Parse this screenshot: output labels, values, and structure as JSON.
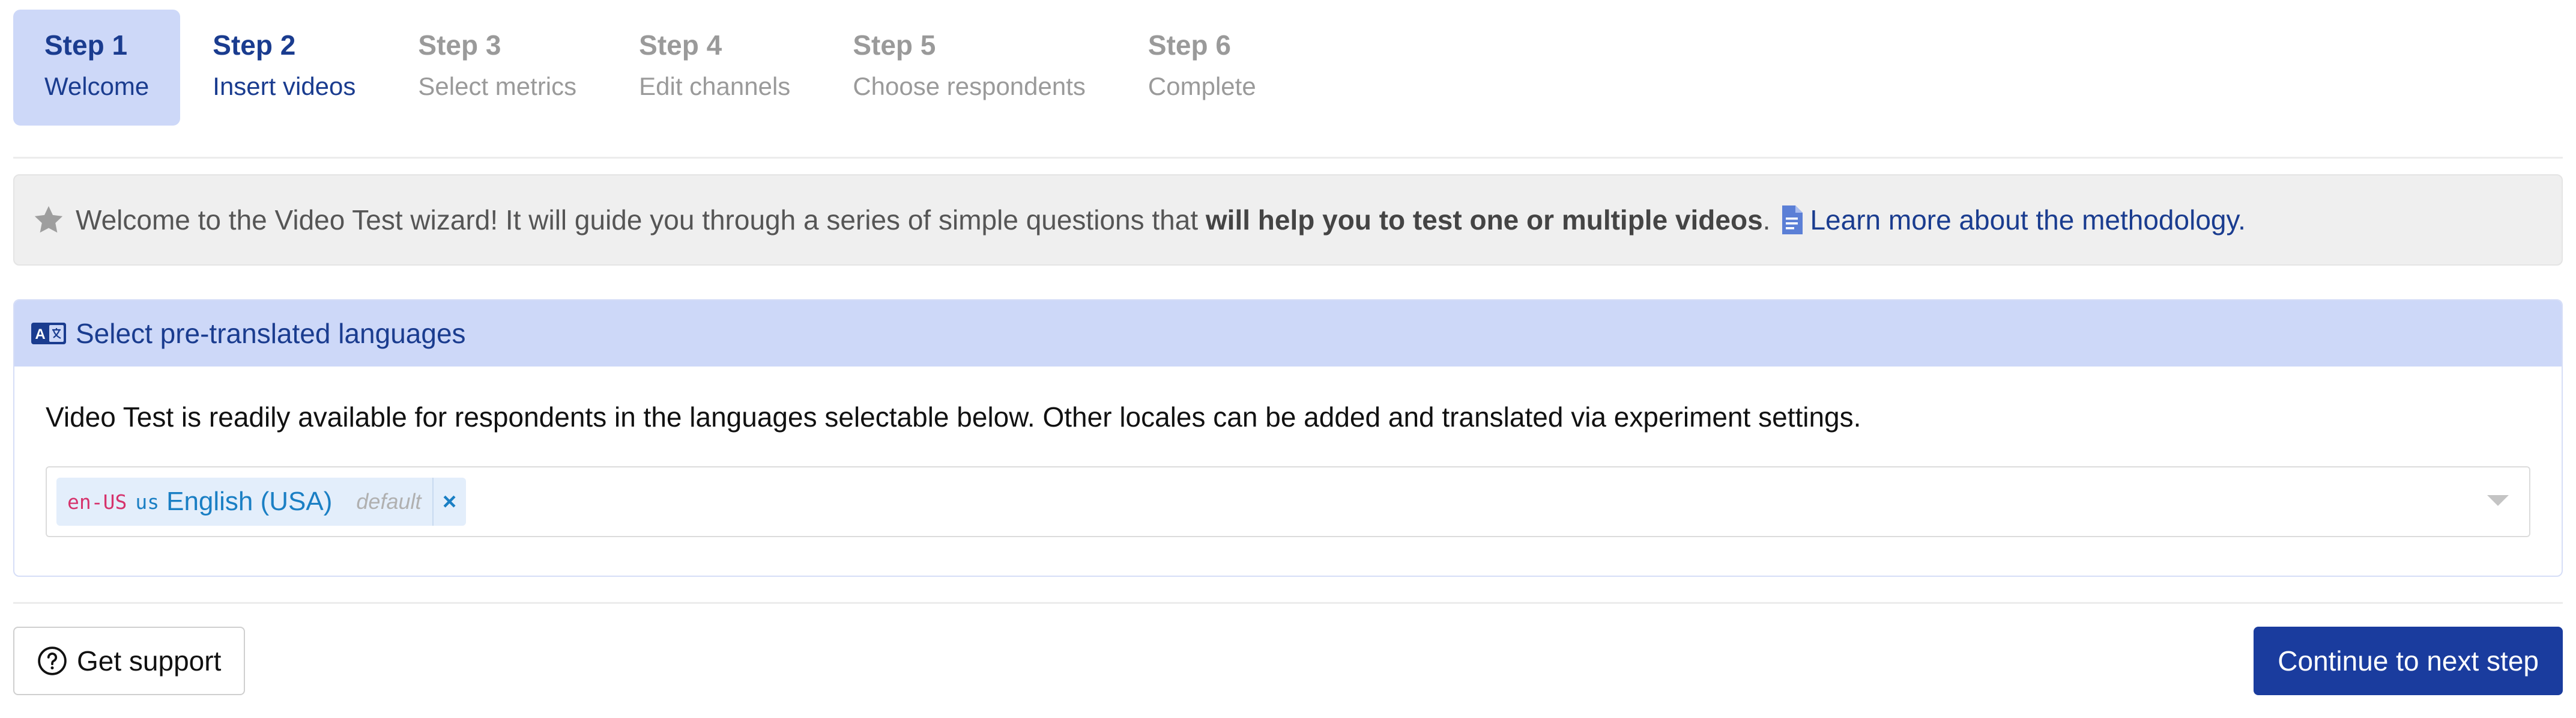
{
  "wizard": {
    "steps": [
      {
        "title": "Step 1",
        "subtitle": "Welcome",
        "state": "active"
      },
      {
        "title": "Step 2",
        "subtitle": "Insert videos",
        "state": "next"
      },
      {
        "title": "Step 3",
        "subtitle": "Select metrics",
        "state": "disabled"
      },
      {
        "title": "Step 4",
        "subtitle": "Edit channels",
        "state": "disabled"
      },
      {
        "title": "Step 5",
        "subtitle": "Choose respondents",
        "state": "disabled"
      },
      {
        "title": "Step 6",
        "subtitle": "Complete",
        "state": "disabled"
      }
    ]
  },
  "welcome": {
    "icon": "star-icon",
    "text_before": "Welcome to the Video Test wizard! It will guide you through a series of simple questions that ",
    "text_bold": "will help you to test one or multiple videos",
    "text_after": ".",
    "link_icon": "document-icon",
    "link_text": "Learn more about the methodology."
  },
  "languages": {
    "header_icon": "translate-icon",
    "header": "Select pre-translated languages",
    "description": "Video Test is readily available for respondents in the languages selectable below. Other locales can be added and translated via experiment settings.",
    "selected": [
      {
        "code": "en-US",
        "country": "us",
        "name": "English (USA)",
        "badge": "default",
        "remove": "×"
      }
    ]
  },
  "footer": {
    "support_icon": "question-circle-icon",
    "support_label": "Get support",
    "next_label": "Continue to next step"
  },
  "colors": {
    "primary": "#1a3c9e",
    "active_step_bg": "#cdd8f8",
    "link": "#1a3c8f",
    "tag_bg": "#e3eefb",
    "code_pink": "#d6336c"
  }
}
